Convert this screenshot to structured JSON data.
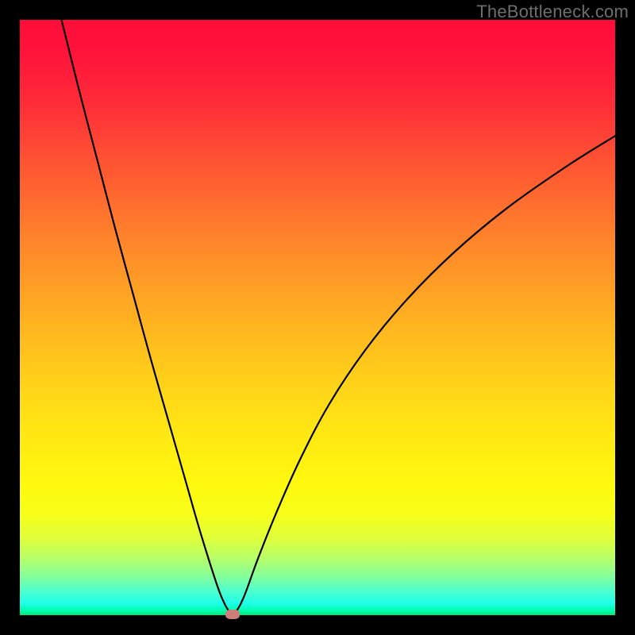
{
  "watermark": "TheBottleneck.com",
  "colors": {
    "curve": "#000000",
    "marker": "#cd7d7a",
    "frame": "#000000"
  },
  "chart_data": {
    "type": "line",
    "title": "",
    "xlabel": "",
    "ylabel": "",
    "xlim": [
      0,
      100
    ],
    "ylim": [
      0,
      100
    ],
    "grid": false,
    "series": [
      {
        "name": "bottleneck-curve",
        "x": [
          7.0,
          10,
          13,
          16,
          19,
          22,
          25,
          28,
          30,
          32,
          33.5,
          34.5,
          35.2,
          35.8,
          36.3,
          37.0,
          38.0,
          40,
          43,
          47,
          52,
          58,
          65,
          73,
          82,
          92,
          100
        ],
        "values": [
          100,
          88,
          76.5,
          65,
          54,
          43,
          32.5,
          22,
          15,
          8.5,
          4.0,
          1.7,
          0.6,
          0.25,
          0.6,
          1.7,
          4.0,
          9.5,
          17,
          26,
          35.5,
          44.5,
          53,
          61,
          68.5,
          75.5,
          80.5
        ]
      }
    ],
    "marker": {
      "x": 35.7,
      "y": 0.2
    },
    "annotations": []
  }
}
